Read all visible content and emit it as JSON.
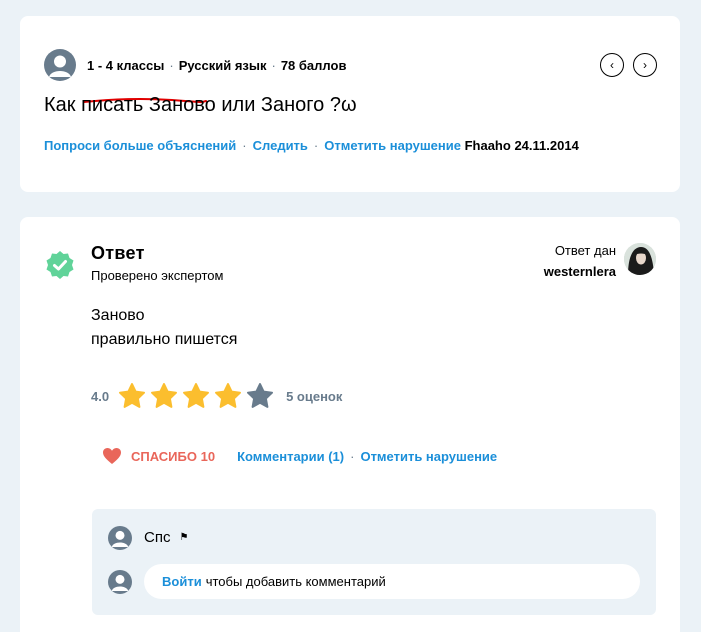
{
  "question": {
    "grade": "1 - 4 классы",
    "subject": "Русский язык",
    "points": "78 баллов",
    "title": "Как писать Заново или Заного ?ω",
    "actions": {
      "ask_more": "Попроси больше объяснений",
      "follow": "Следить",
      "report": "Отметить нарушение"
    },
    "author": "Fhaaho",
    "date": "24.11.2014",
    "nav": {
      "prev": "‹",
      "next": "›"
    }
  },
  "answer": {
    "heading": "Ответ",
    "verified_label": "Проверено экспертом",
    "answered_by_label": "Ответ дан",
    "answerer": "westernlera",
    "text_line1": "Заново",
    "text_line2": "правильно пишется",
    "rating_value": "4.0",
    "rating_stars": 4,
    "rating_max": 5,
    "rating_count": "5 оценок",
    "thanks_label": "СПАСИБО 10",
    "comments_link": "Комментарии (1)",
    "report": "Отметить нарушение"
  },
  "comments": {
    "items": [
      {
        "text": "Спс",
        "flag_icon": "flag-icon"
      }
    ],
    "add_link": "Войти",
    "add_suffix": "чтобы добавить комментарий"
  },
  "colors": {
    "background": "#ebf2f7",
    "link": "#1b8fd9",
    "verified": "#60d399",
    "star_filled": "#fbbe2e",
    "star_empty": "#687b8c",
    "thanks": "#e9665a",
    "avatar": "#687b8c",
    "annotation": "#e00000"
  }
}
